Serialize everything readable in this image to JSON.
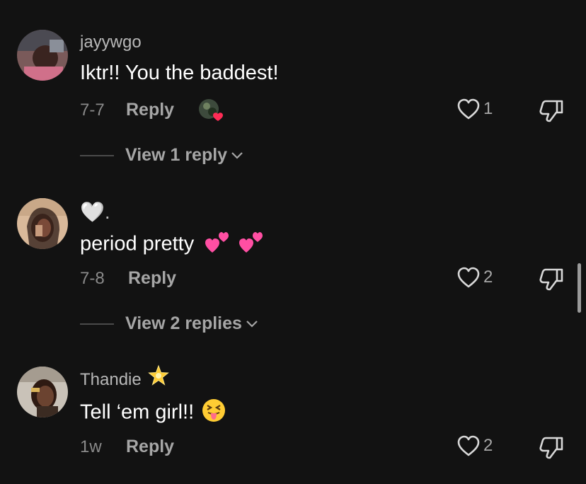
{
  "comments": [
    {
      "username": "jayywgo",
      "text": "Iktr!! You the baddest!",
      "date": "7-7",
      "reply_label": "Reply",
      "likes": "1",
      "creator_liked": true,
      "view_replies": "View 1 reply"
    },
    {
      "username": "🤍.",
      "text": "period pretty",
      "date": "7-8",
      "reply_label": "Reply",
      "likes": "2",
      "view_replies": "View 2 replies"
    },
    {
      "username": "Thandie",
      "text": "Tell ‘em girl!!",
      "date": "1w",
      "reply_label": "Reply",
      "likes": "2"
    }
  ],
  "colors": {
    "background": "#121212",
    "secondary_text": "#a6a6a6",
    "heart_red": "#fe2c55",
    "emoji_pink": "#ff4fa3"
  }
}
